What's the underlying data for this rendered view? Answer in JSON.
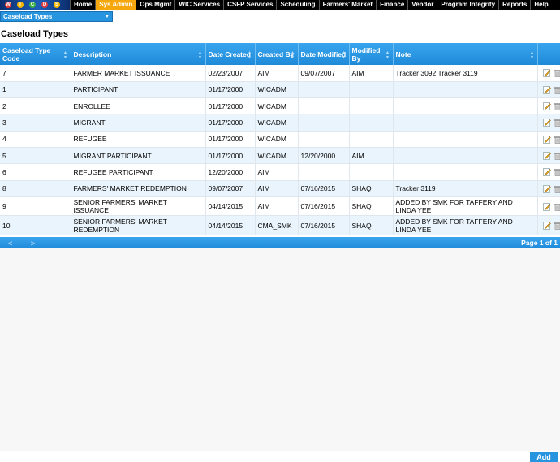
{
  "nav": {
    "logo_letters": [
      "W",
      "I",
      "C",
      "D",
      "S"
    ],
    "items": [
      "Home",
      "Sys Admin",
      "Ops Mgmt",
      "WIC Services",
      "CSFP Services",
      "Scheduling",
      "Farmers' Market",
      "Finance",
      "Vendor",
      "Program Integrity",
      "Reports",
      "Help"
    ],
    "active": "Sys Admin"
  },
  "submenu": {
    "label": "Caseload Types"
  },
  "page_title": "Caseload Types",
  "table": {
    "columns": [
      "Caseload Type Code",
      "Description",
      "Date Created",
      "Created By",
      "Date Modified",
      "Modified By",
      "Note"
    ],
    "rows": [
      [
        "7",
        "FARMER MARKET ISSUANCE",
        "02/23/2007",
        "AIM",
        "09/07/2007",
        "AIM",
        "Tracker 3092 Tracker 3119"
      ],
      [
        "1",
        "PARTICIPANT",
        "01/17/2000",
        "WICADM",
        "",
        "",
        ""
      ],
      [
        "2",
        "ENROLLEE",
        "01/17/2000",
        "WICADM",
        "",
        "",
        ""
      ],
      [
        "3",
        "MIGRANT",
        "01/17/2000",
        "WICADM",
        "",
        "",
        ""
      ],
      [
        "4",
        "REFUGEE",
        "01/17/2000",
        "WICADM",
        "",
        "",
        ""
      ],
      [
        "5",
        "MIGRANT PARTICIPANT",
        "01/17/2000",
        "WICADM",
        "12/20/2000",
        "AIM",
        ""
      ],
      [
        "6",
        "REFUGEE PARTICIPANT",
        "12/20/2000",
        "AIM",
        "",
        "",
        ""
      ],
      [
        "8",
        "FARMERS' MARKET REDEMPTION",
        "09/07/2007",
        "AIM",
        "07/16/2015",
        "SHAQ",
        "Tracker 3119"
      ],
      [
        "9",
        "SENIOR FARMERS' MARKET ISSUANCE",
        "04/14/2015",
        "AIM",
        "07/16/2015",
        "SHAQ",
        "ADDED BY SMK FOR TAFFERY AND LINDA YEE"
      ],
      [
        "10",
        "SENIOR FARMERS' MARKET REDEMPTION",
        "04/14/2015",
        "CMA_SMK",
        "07/16/2015",
        "SHAQ",
        "ADDED BY SMK FOR TAFFERY AND LINDA YEE"
      ]
    ]
  },
  "pager": {
    "prev": "<",
    "next": ">",
    "page_text": "Page 1 of 1"
  },
  "buttons": {
    "add": "Add"
  }
}
